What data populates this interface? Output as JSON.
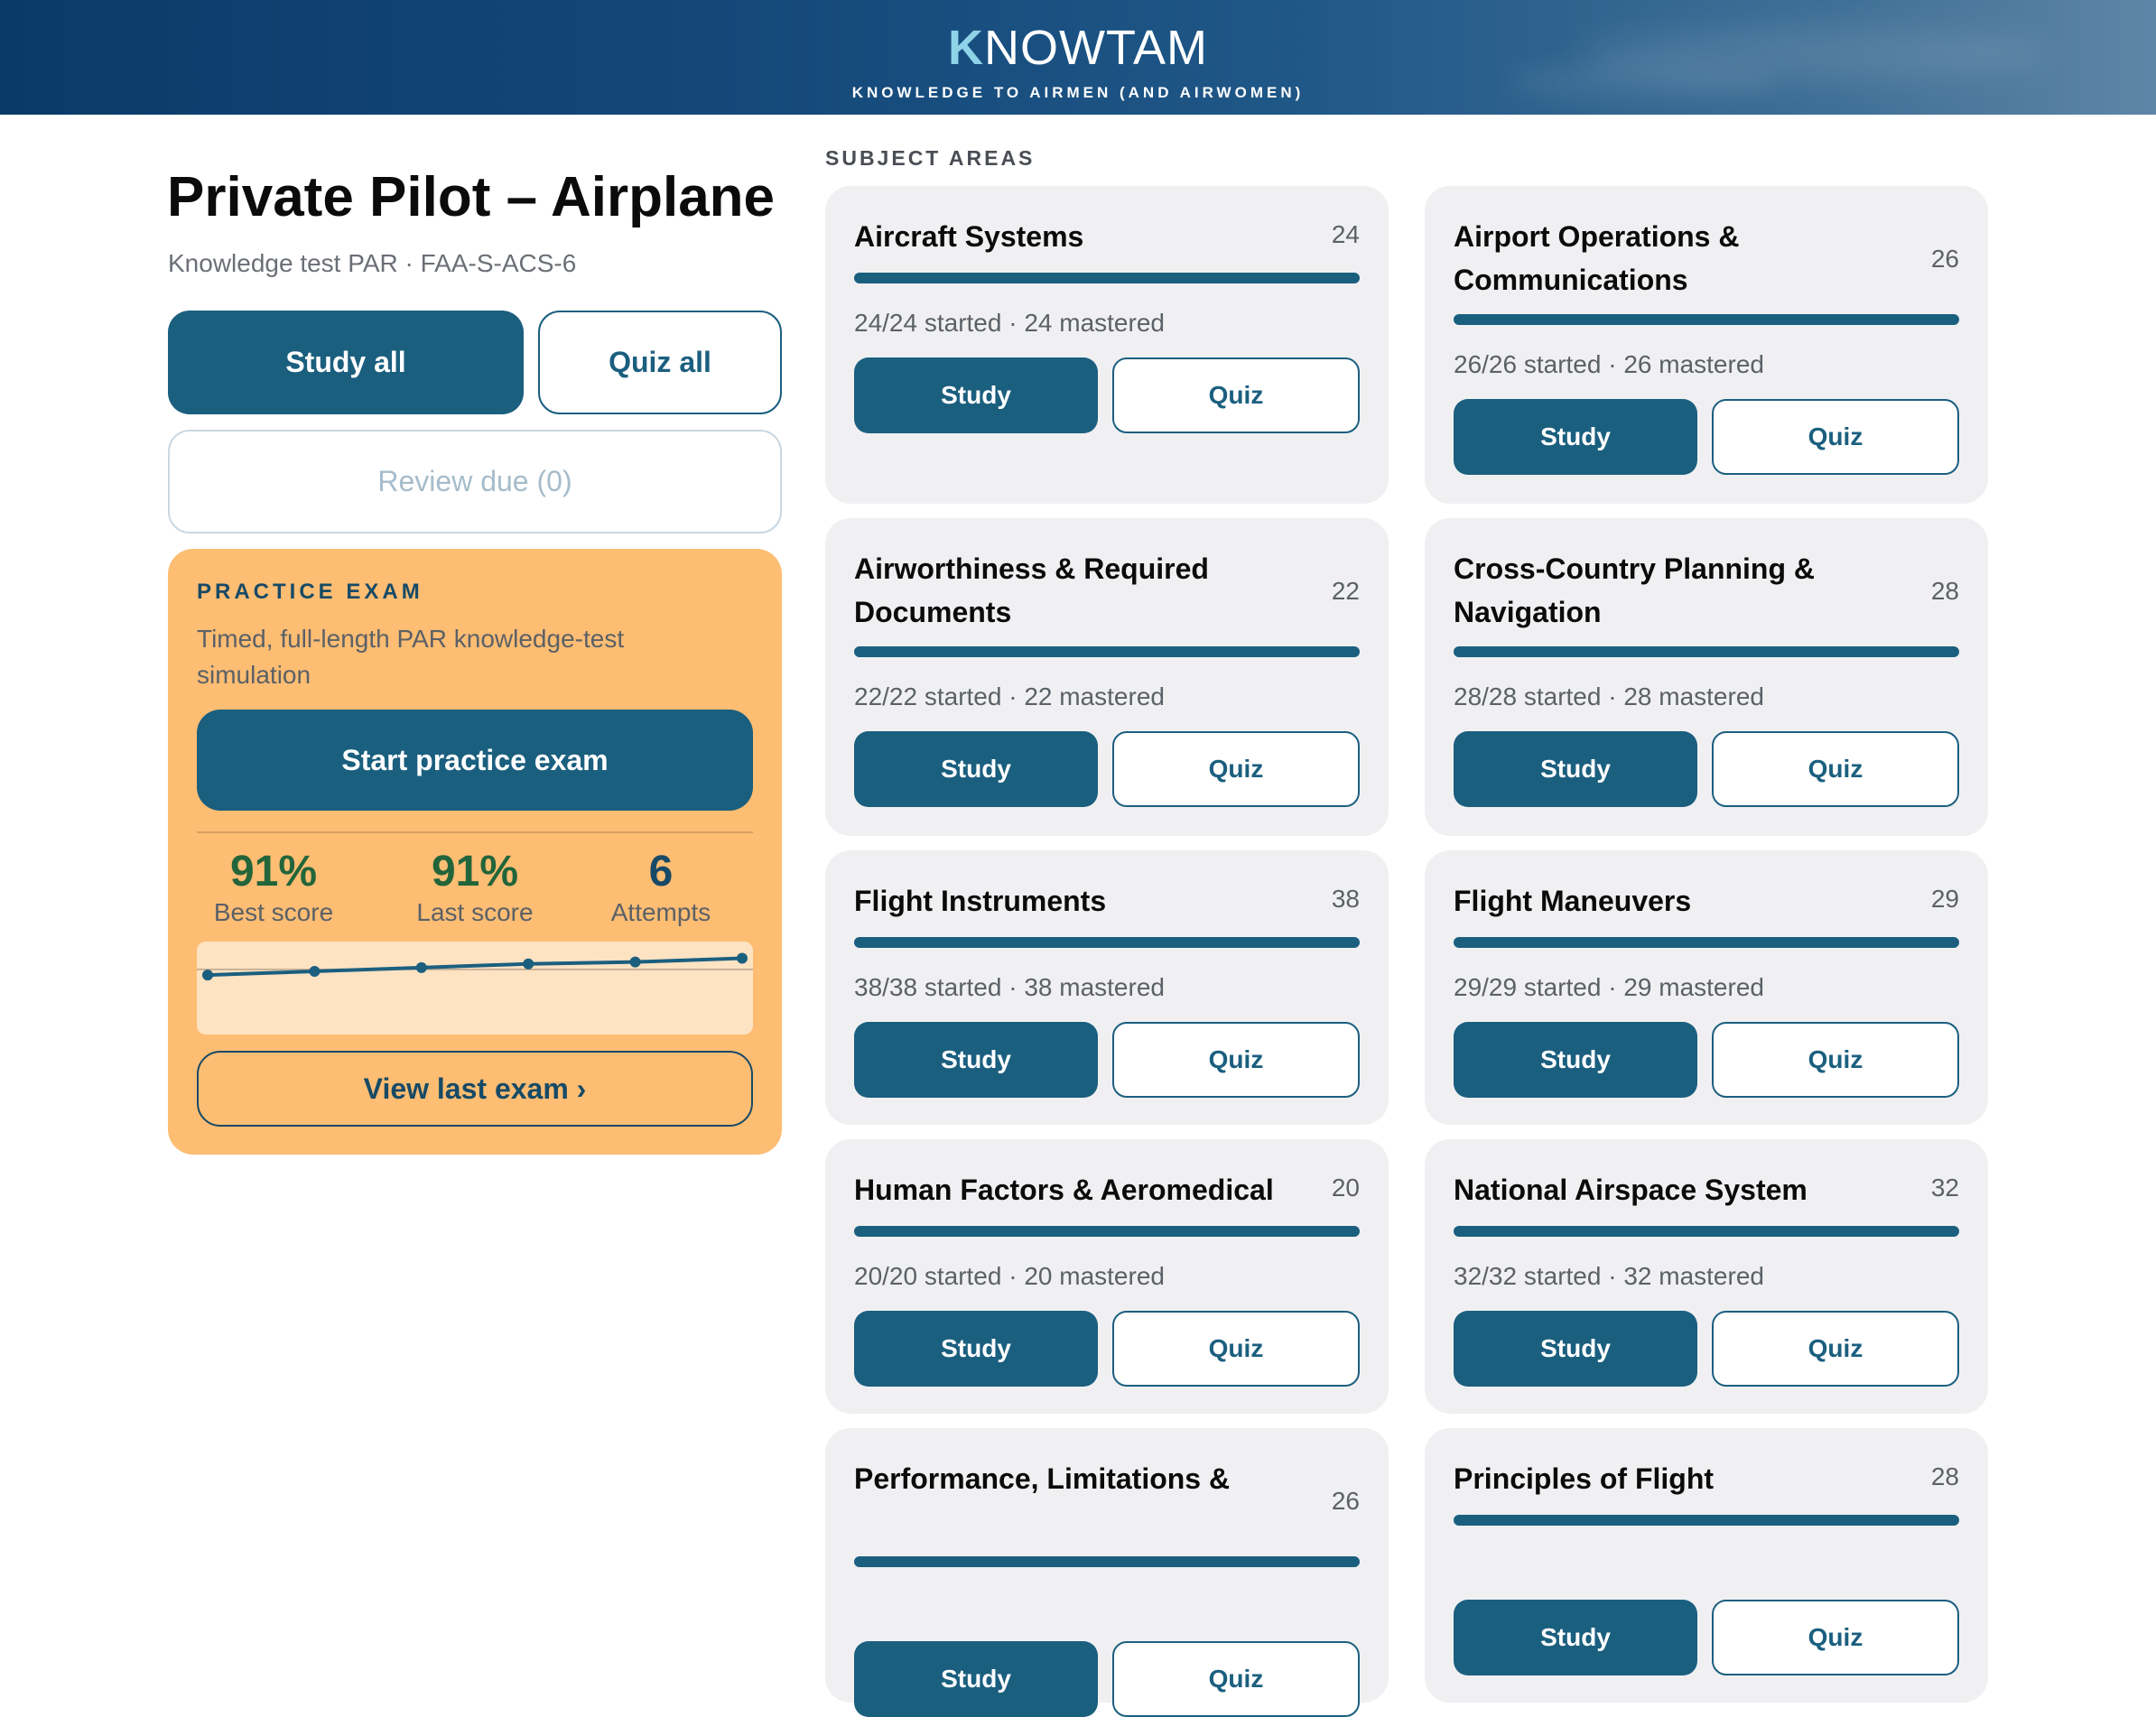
{
  "header": {
    "logo_k": "K",
    "logo_rest": "NOWTAM",
    "tagline": "KNOWLEDGE TO AIRMEN (AND AIRWOMEN)"
  },
  "course": {
    "title": "Private Pilot – Airplane",
    "subtitle": "Knowledge test PAR · FAA-S-ACS-6",
    "study_all_label": "Study all",
    "quiz_all_label": "Quiz all",
    "review_due_label": "Review due (0)"
  },
  "practice_exam": {
    "kicker": "PRACTICE EXAM",
    "description": "Timed, full-length PAR knowledge-test simulation",
    "start_label": "Start practice exam",
    "stats": [
      {
        "value": "91%",
        "label": "Best score"
      },
      {
        "value": "91%",
        "label": "Last score"
      },
      {
        "value": "6",
        "label": "Attempts"
      }
    ],
    "view_last_label": "View last exam ›",
    "colors": {
      "card": "#fdbd73",
      "accent": "#174a66",
      "good": "#23653a"
    }
  },
  "chart_data": {
    "type": "line",
    "title": "",
    "xlabel": "",
    "ylabel": "",
    "x": [
      1,
      2,
      3,
      4,
      5,
      6
    ],
    "series": [
      {
        "values": [
          82,
          84,
          86,
          88,
          89,
          91
        ]
      }
    ],
    "ylim": [
      50,
      100
    ],
    "reference_line": 85,
    "grid": false
  },
  "subjects": {
    "section_label": "SUBJECT AREAS",
    "study_label": "Study",
    "quiz_label": "Quiz",
    "items": [
      {
        "title": "Aircraft Systems",
        "count": "24",
        "progress": "24/24 started · 24 mastered",
        "fraction": 1.0
      },
      {
        "title": "Airport Operations & Communications",
        "count": "26",
        "progress": "26/26 started · 26 mastered",
        "fraction": 1.0
      },
      {
        "title": "Airworthiness & Required Documents",
        "count": "22",
        "progress": "22/22 started · 22 mastered",
        "fraction": 1.0
      },
      {
        "title": "Cross-Country Planning & Navigation",
        "count": "28",
        "progress": "28/28 started · 28 mastered",
        "fraction": 1.0
      },
      {
        "title": "Flight Instruments",
        "count": "38",
        "progress": "38/38 started · 38 mastered",
        "fraction": 1.0
      },
      {
        "title": "Flight Maneuvers",
        "count": "29",
        "progress": "29/29 started · 29 mastered",
        "fraction": 1.0
      },
      {
        "title": "Human Factors & Aeromedical",
        "count": "20",
        "progress": "20/20 started · 20 mastered",
        "fraction": 1.0
      },
      {
        "title": "National Airspace System",
        "count": "32",
        "progress": "32/32 started · 32 mastered",
        "fraction": 1.0
      },
      {
        "title": "Performance, Limitations &",
        "count": "26",
        "progress": "",
        "fraction": 1.0
      },
      {
        "title": "Principles of Flight",
        "count": "28",
        "progress": "",
        "fraction": 1.0
      }
    ]
  }
}
